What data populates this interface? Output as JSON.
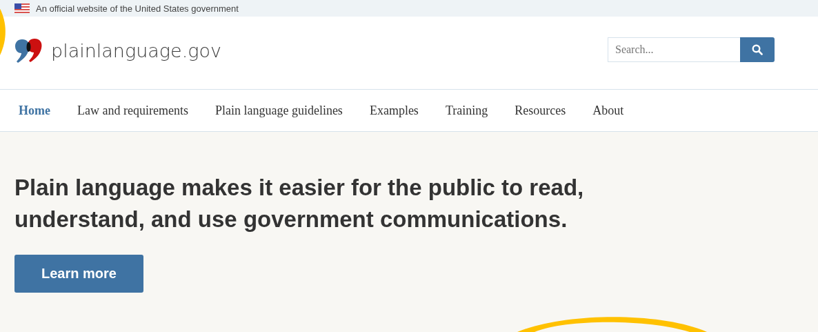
{
  "banner": {
    "text": "An official website of the United States government"
  },
  "site": {
    "name": "plainlanguage.gov"
  },
  "search": {
    "placeholder": "Search..."
  },
  "nav": [
    {
      "label": "Home",
      "selected": true
    },
    {
      "label": "Law and requirements",
      "selected": false
    },
    {
      "label": "Plain language guidelines",
      "selected": false
    },
    {
      "label": "Examples",
      "selected": false
    },
    {
      "label": "Training",
      "selected": false
    },
    {
      "label": "Resources",
      "selected": false
    },
    {
      "label": "About",
      "selected": false
    }
  ],
  "hero": {
    "headline": "Plain language makes it easier for the public to read, understand, and use government communications.",
    "button": "Learn more"
  }
}
